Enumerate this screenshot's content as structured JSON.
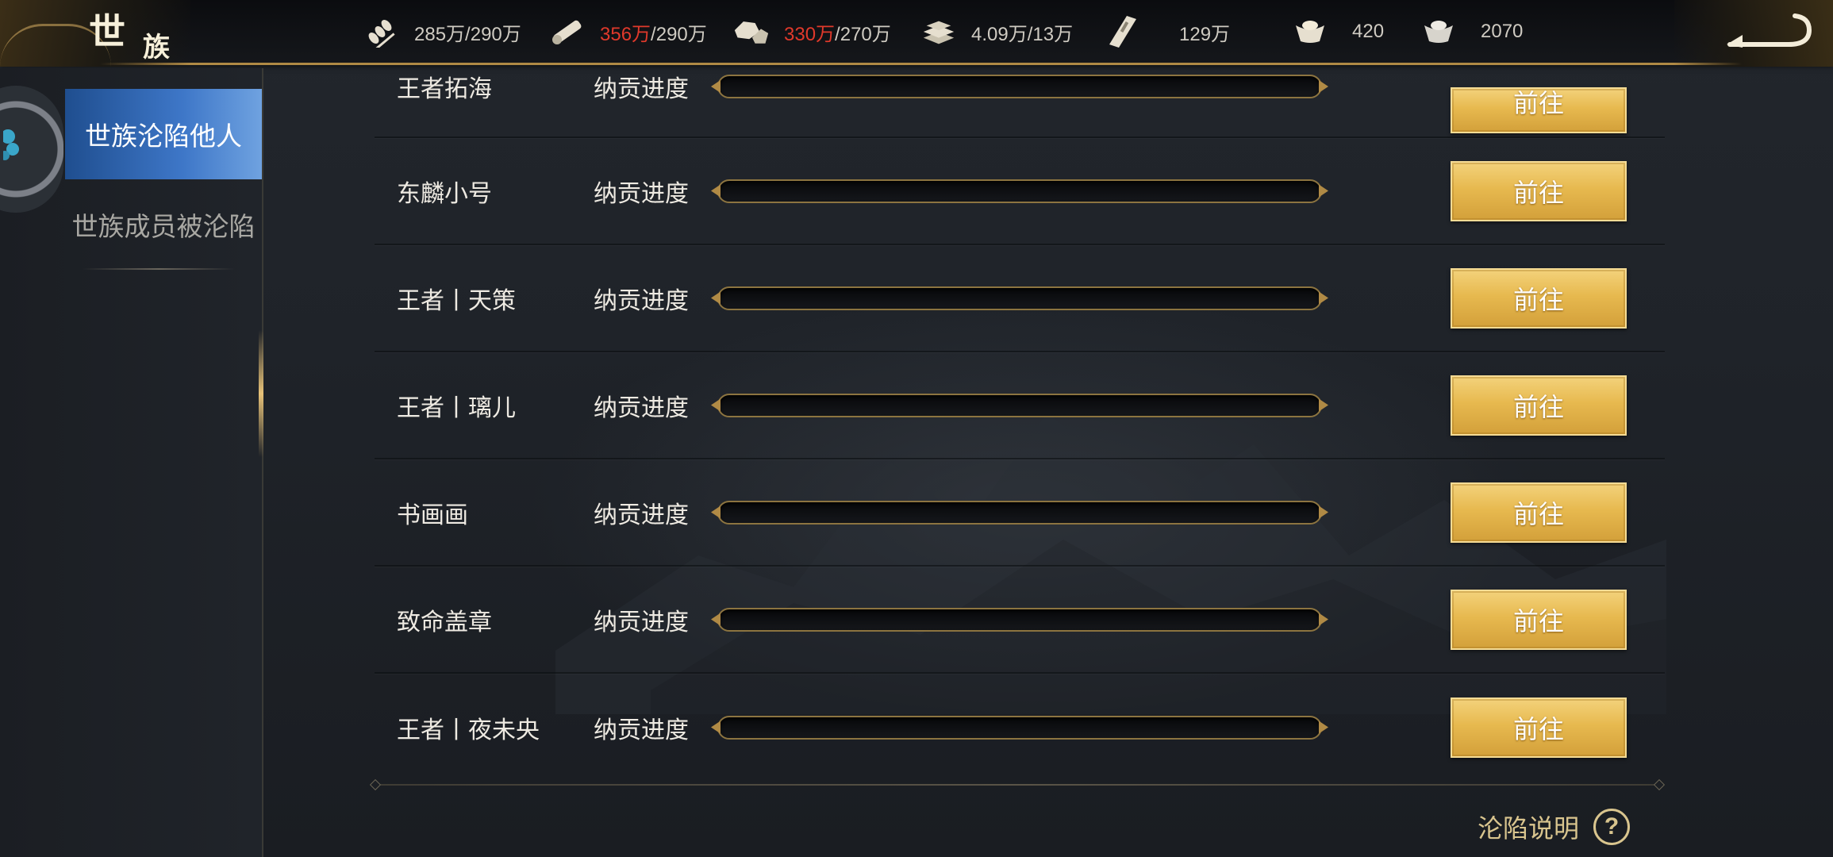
{
  "header": {
    "title_char1": "世",
    "title_char2": "族",
    "resources": [
      {
        "icon": "grain-icon",
        "current": "285万",
        "max": "/290万",
        "over_limit": false
      },
      {
        "icon": "wood-icon",
        "current": "356万",
        "max": "/290万",
        "over_limit": true
      },
      {
        "icon": "stone-icon",
        "current": "330万",
        "max": "/270万",
        "over_limit": true
      },
      {
        "icon": "iron-icon",
        "current": "4.09万",
        "max": "/13万",
        "over_limit": false
      },
      {
        "icon": "copper-coin-icon",
        "current": "129万",
        "max": "",
        "over_limit": false
      },
      {
        "icon": "gold-ingot-icon",
        "current": "420",
        "max": "",
        "over_limit": false
      },
      {
        "icon": "silver-ingot-icon",
        "current": "2070",
        "max": "",
        "over_limit": false
      }
    ],
    "colors": {
      "over_limit": "#e0392b",
      "normal": "#cfcbc2",
      "accent_gold": "#b08a45"
    }
  },
  "sidebar": {
    "tabs": [
      {
        "label": "世族沦陷他人",
        "active": true
      },
      {
        "label": "世族成员被沦陷",
        "active": false
      }
    ],
    "active_color": "#3e77c8"
  },
  "list": {
    "rows": [
      {
        "name": "王者拓海",
        "label": "纳贡进度",
        "progress": 0,
        "button": "前往"
      },
      {
        "name": "东麟小号",
        "label": "纳贡进度",
        "progress": 0,
        "button": "前往"
      },
      {
        "name": "王者丨天策",
        "label": "纳贡进度",
        "progress": 0,
        "button": "前往"
      },
      {
        "name": "王者丨璃儿",
        "label": "纳贡进度",
        "progress": 0,
        "button": "前往"
      },
      {
        "name": "书画画",
        "label": "纳贡进度",
        "progress": 0,
        "button": "前往"
      },
      {
        "name": "致命盖章",
        "label": "纳贡进度",
        "progress": 0,
        "button": "前往"
      },
      {
        "name": "王者丨夜未央",
        "label": "纳贡进度",
        "progress": 0,
        "button": "前往"
      }
    ],
    "button_color": "#e7b94f"
  },
  "footer": {
    "explain_label": "沦陷说明",
    "help_glyph": "?"
  }
}
